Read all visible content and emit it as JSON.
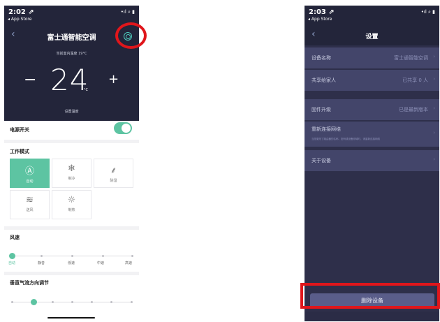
{
  "left": {
    "status_time": "2:02 ⇗",
    "status_sub": "◂ App Store",
    "status_icons": "•ıl ⌕ ▮",
    "back_icon": "‹",
    "title": "富士通智能空调",
    "room_temp": "当前室内温度 19°C",
    "minus": "−",
    "plus": "+",
    "setpoint": "24",
    "unit": "°C",
    "set_label": "设置温度",
    "power_label": "电源开关",
    "power_on": true,
    "mode_title": "工作模式",
    "modes": [
      {
        "label": "自动",
        "icon": "Ⓐ",
        "active": true
      },
      {
        "label": "制冷",
        "icon": "❄",
        "active": false
      },
      {
        "label": "除湿",
        "icon": "⸙",
        "active": false
      },
      {
        "label": "送风",
        "icon": "≋",
        "active": false
      },
      {
        "label": "制热",
        "icon": "☼",
        "active": false
      }
    ],
    "wind_title": "风速",
    "wind_levels": [
      "自动",
      "静音",
      "低速",
      "中速",
      "高速"
    ],
    "wind_selected": 0,
    "vertical_title": "垂直气流方向调节",
    "vertical_selected": 1,
    "accent": "#5dc4a2",
    "highlight": "#e0161b"
  },
  "right": {
    "status_time": "2:03 ⇗",
    "status_sub": "◂ App Store",
    "status_icons": "•ıl ⌕ ▮",
    "back_icon": "‹",
    "title": "设置",
    "rows": [
      {
        "label": "设备名称",
        "value": "富士通智能空调"
      },
      {
        "label": "共享给家人",
        "value": "已共享 0 人"
      },
      {
        "label": "固件升级",
        "value": "已是最新版本"
      },
      {
        "label": "重新连接网络",
        "value": "",
        "sub": "当您更改了路由器的名称、密码或设备领域时，请重新连接网络"
      },
      {
        "label": "关于设备",
        "value": ""
      }
    ],
    "chevron": "›",
    "delete_label": "删除设备"
  }
}
